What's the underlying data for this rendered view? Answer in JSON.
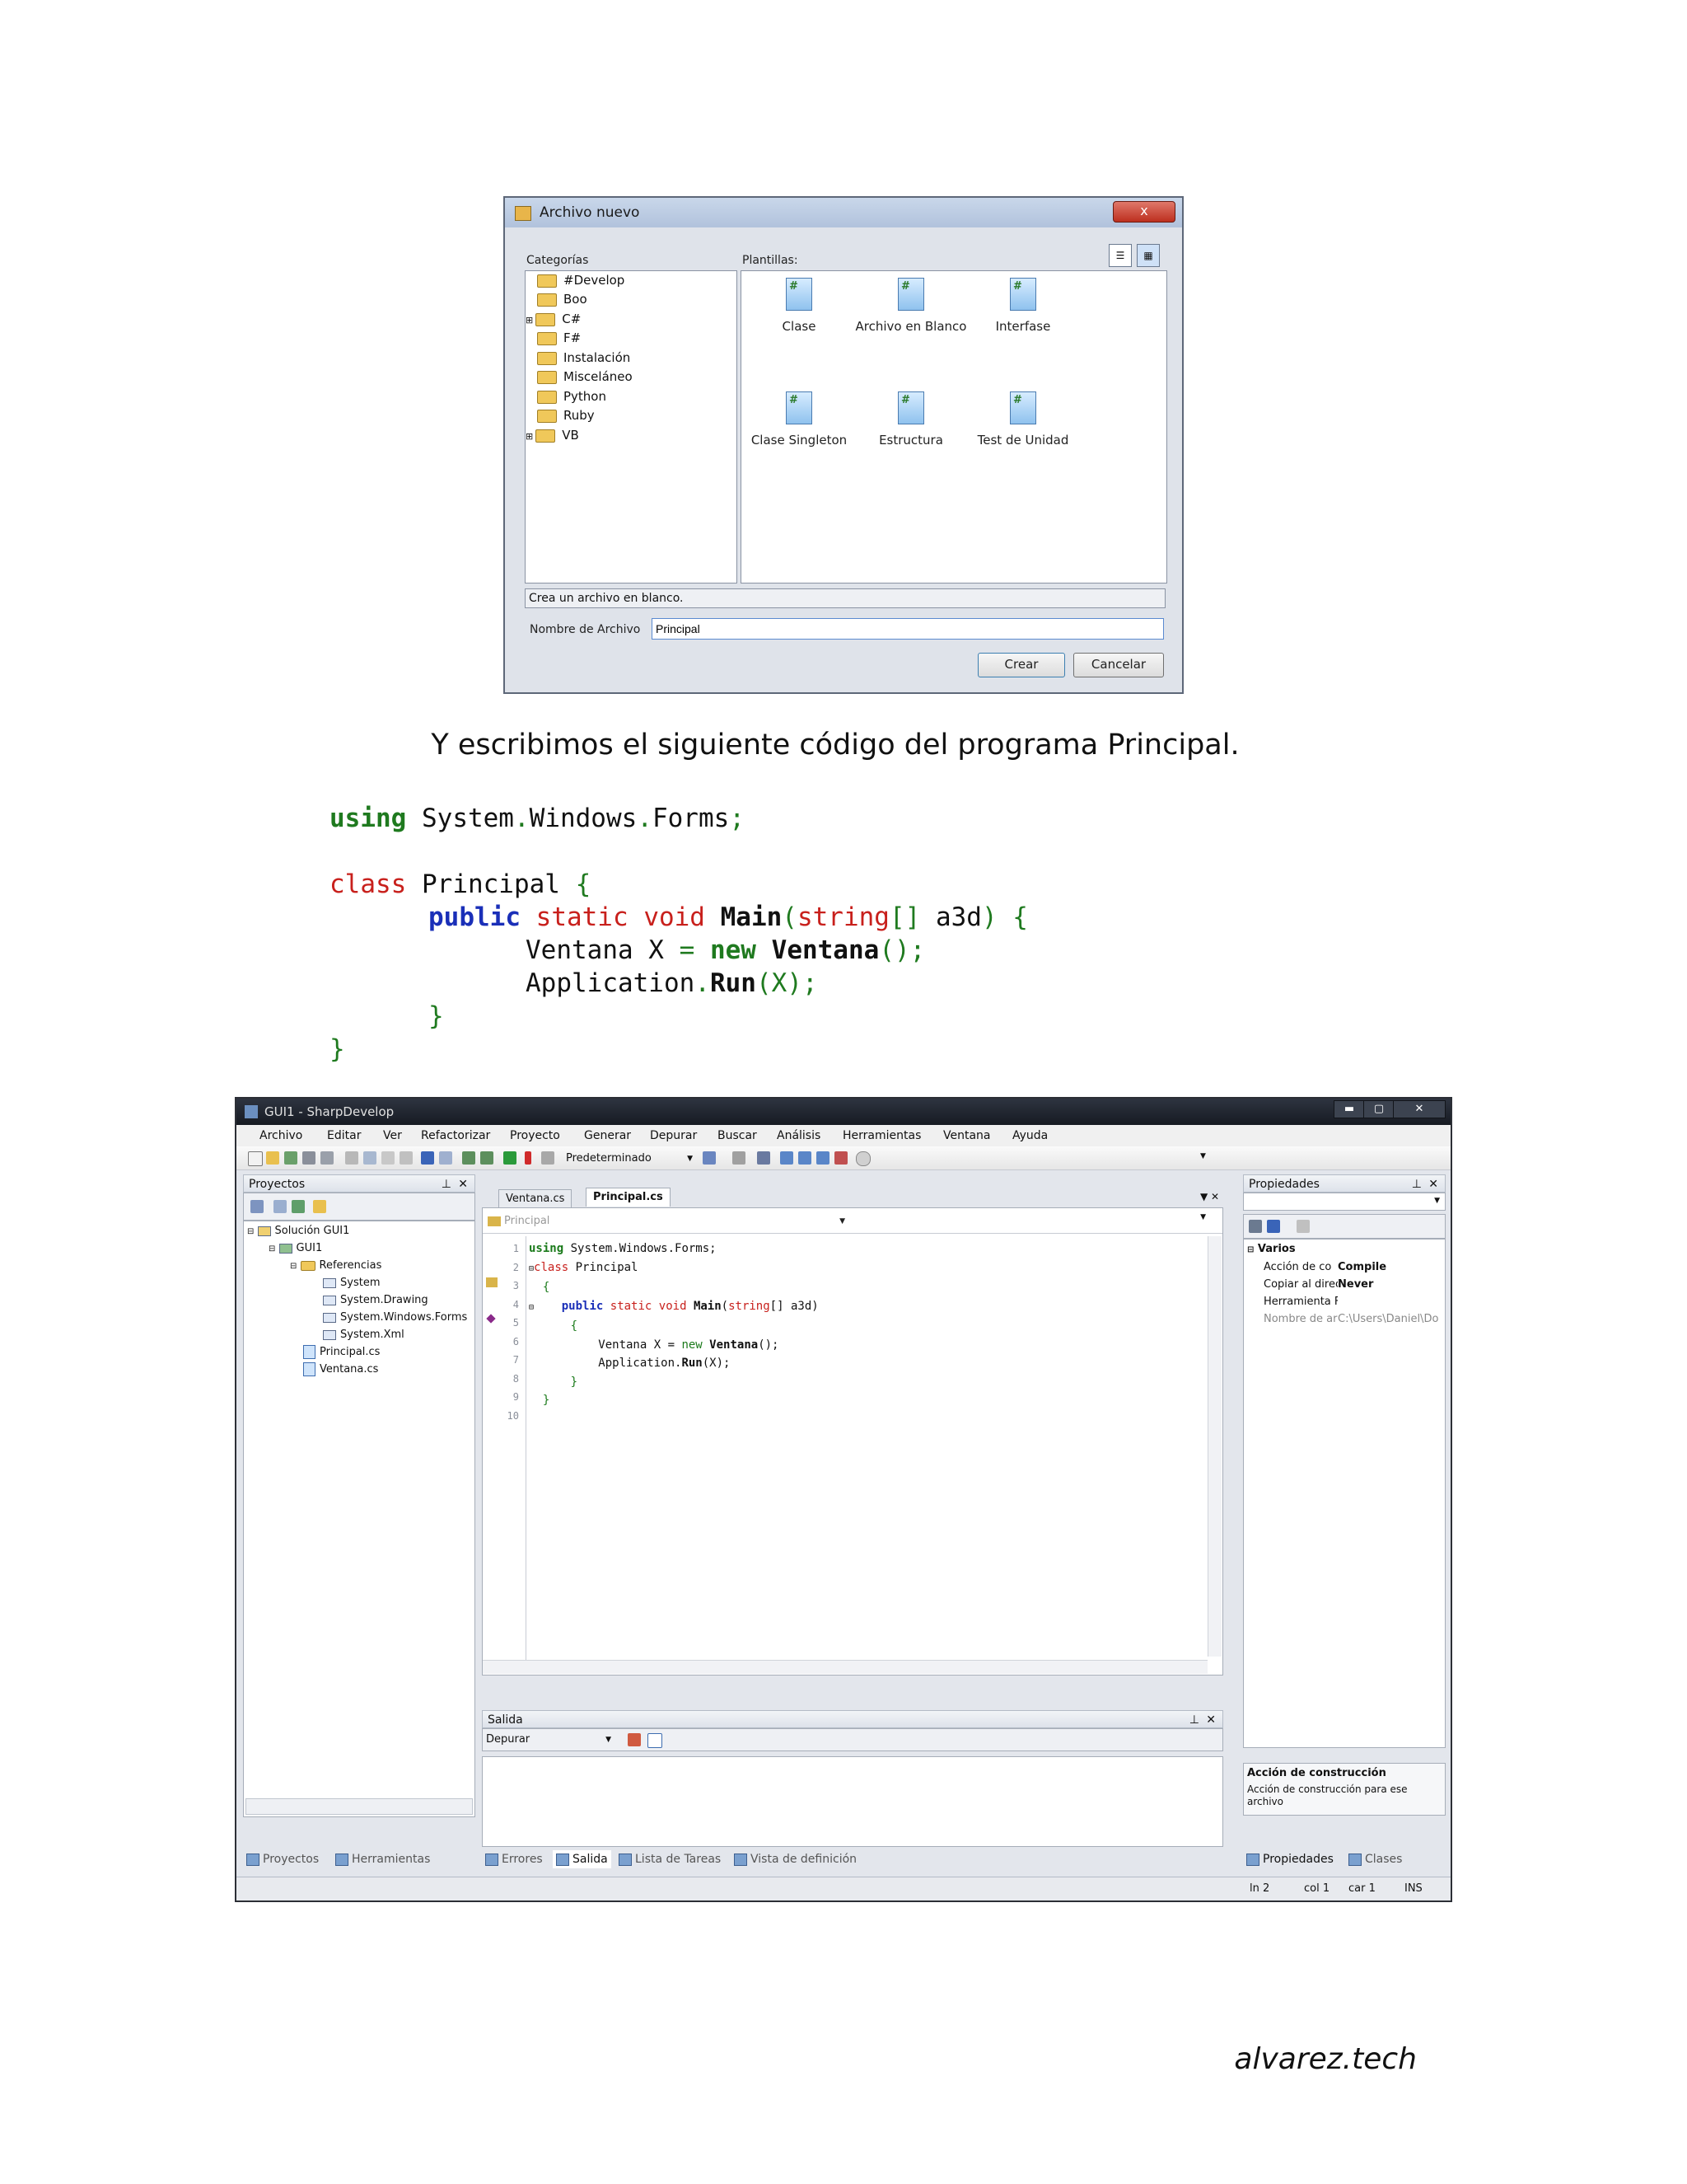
{
  "dialog": {
    "title": "Archivo nuevo",
    "close": "x",
    "categories_label": "Categorías",
    "templates_label": "Plantillas:",
    "categories": [
      "#Develop",
      "Boo",
      "C#",
      "F#",
      "Instalación",
      "Misceláneo",
      "Python",
      "Ruby",
      "VB"
    ],
    "templates": [
      "Clase",
      "Archivo en Blanco",
      "Interfase",
      "Clase Singleton",
      "Estructura",
      "Test de Unidad"
    ],
    "description": "Crea un archivo en blanco.",
    "filename_label": "Nombre de Archivo",
    "filename_value": "Principal",
    "create_button": "Crear",
    "cancel_button": "Cancelar"
  },
  "caption": "Y escribimos el siguiente código del programa Principal.",
  "code": {
    "l1_kw": "using",
    "l1_rest": " System",
    "l1_dot1": ".",
    "l1_b": "Windows",
    "l1_dot2": ".",
    "l1_c": "Forms",
    "l1_semi": ";",
    "l2_kw": "class",
    "l2_name": " Principal ",
    "l2_brace": "{",
    "l3_public": "public",
    "l3_static": "static",
    "l3_void": "void",
    "l3_main": "Main",
    "l3_paren": "(",
    "l3_string": "string",
    "l3_arr": "[]",
    "l3_arg": " a3d",
    "l3_close": ")",
    "l3_brace": " {",
    "l4_type": "Ventana X ",
    "l4_eq": "=",
    "l4_new": "new",
    "l4_ctor": "Ventana",
    "l4_tail": "();",
    "l5_app": "Application",
    "l5_dot": ".",
    "l5_run": "Run",
    "l5_args": "(X);",
    "l6_brace": "}",
    "l7_brace": "}"
  },
  "ide": {
    "title": "GUI1 - SharpDevelop",
    "window_buttons": [
      "▬",
      "▢",
      "✕"
    ],
    "menu": [
      "Archivo",
      "Editar",
      "Ver",
      "Refactorizar",
      "Proyecto",
      "Generar",
      "Depurar",
      "Buscar",
      "Análisis",
      "Herramientas",
      "Ventana",
      "Ayuda"
    ],
    "config": "Predeterminado",
    "projects_header": "Proyectos",
    "solution": "Solución GUI1",
    "project": "GUI1",
    "references": "Referencias",
    "refs": [
      "System",
      "System.Drawing",
      "System.Windows.Forms",
      "System.Xml"
    ],
    "files": [
      "Principal.cs",
      "Ventana.cs"
    ],
    "tabs": [
      "Ventana.cs",
      "Principal.cs"
    ],
    "class_combo": "Principal",
    "line_numbers": [
      "1",
      "2",
      "3",
      "4",
      "5",
      "6",
      "7",
      "8",
      "9",
      "10"
    ],
    "editor_lines": [
      "using System.Windows.Forms;",
      "",
      "class Principal",
      "{",
      "    public static void Main(string[] a3d)",
      "    {",
      "        Ventana X = new Ventana();",
      "        Application.Run(X);",
      "    }",
      "}"
    ],
    "properties_header": "Propiedades",
    "prop_group": "Varios",
    "props": [
      {
        "name": "Acción de co",
        "value": "Compile"
      },
      {
        "name": "Copiar al direc",
        "value": "Never"
      },
      {
        "name": "Herramienta F",
        "value": ""
      },
      {
        "name": "Nombre de ar",
        "value": "C:\\Users\\Daniel\\Do"
      }
    ],
    "prop_desc_title": "Acción de construcción",
    "prop_desc_text": "Acción de construcción para ese archivo",
    "output_header": "Salida",
    "output_combo": "Depurar",
    "bottom_left_tabs": [
      "Proyectos",
      "Herramientas"
    ],
    "bottom_mid_tabs": [
      "Errores",
      "Salida",
      "Lista de Tareas",
      "Vista de definición"
    ],
    "bottom_right_tabs": [
      "Propiedades",
      "Clases"
    ],
    "status": [
      "ln 2",
      "col 1",
      "car 1",
      "INS"
    ],
    "pin": "⊥",
    "close": "✕"
  },
  "footer": "alvarez.tech"
}
